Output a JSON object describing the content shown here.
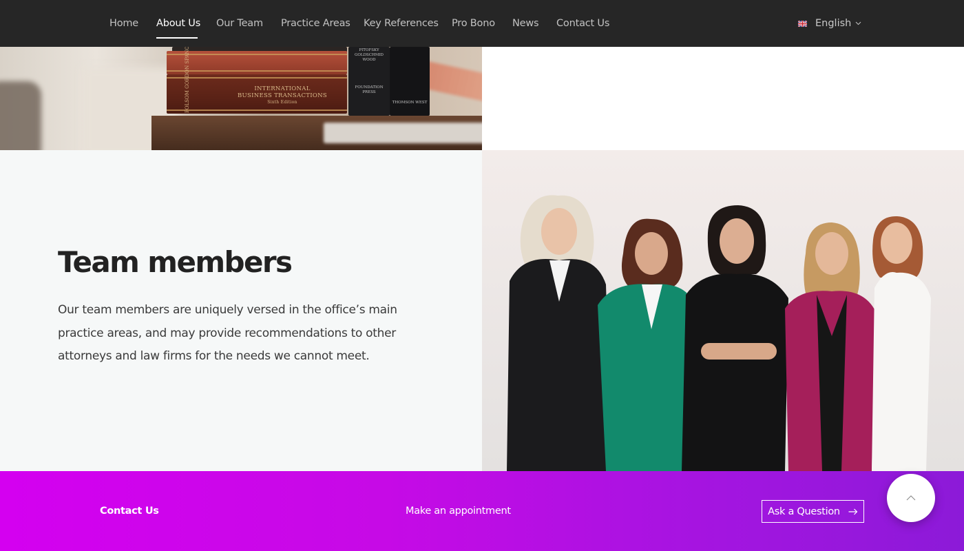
{
  "nav": {
    "items": [
      {
        "label": "Home"
      },
      {
        "label": "About Us"
      },
      {
        "label": "Our Team"
      },
      {
        "label": "Practice Areas"
      },
      {
        "label": "Key References"
      },
      {
        "label": "Pro Bono"
      },
      {
        "label": "News"
      },
      {
        "label": "Contact Us"
      }
    ],
    "active_label": "About Us",
    "language": {
      "label": "English",
      "flag_icon": "uk-flag-icon",
      "chevron_icon": "chevron-down-icon"
    }
  },
  "books_image": {
    "title_line1": "INTERNATIONAL",
    "title_line2": "BUSINESS TRANSACTIONS",
    "edition": "Sixth Edition",
    "authors": "FOLSOM GORDON SPANOGLE",
    "spine_top": "PITOFSKY GOLDSCHMID WOOD",
    "spine_bottom": "FOUNDATION PRESS",
    "spine_publisher": "THOMSON WEST"
  },
  "team": {
    "title": "Team members",
    "description": "Our team members are uniquely versed in the office’s main practice areas, and may provide recommendations to other attorneys and law firms for the needs we cannot meet."
  },
  "footer": {
    "contact_label": "Contact Us",
    "appointment_label": "Make an appointment",
    "ask_label": "Ask a Question",
    "ask_icon": "arrow-right-icon",
    "gradient_start": "#d400f0",
    "gradient_end": "#8c1ad8"
  },
  "scroll_top": {
    "icon": "chevron-up-icon"
  },
  "colors": {
    "nav_bg": "#262626",
    "nav_active": "#ffffff",
    "nav_text": "#c2c2c2",
    "section_bg": "#f6f8f8"
  }
}
